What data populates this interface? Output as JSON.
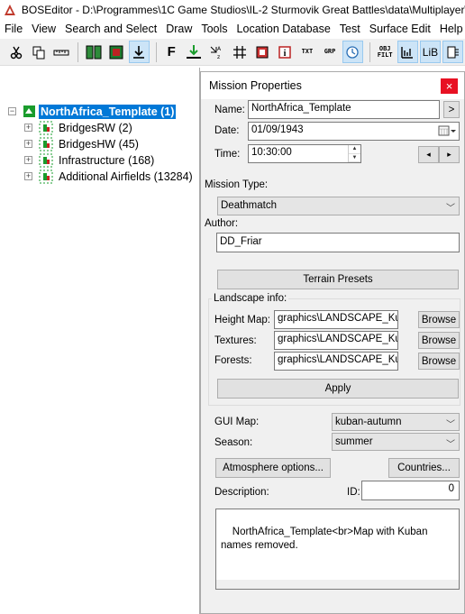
{
  "window": {
    "title": "BOSEditor - D:\\Programmes\\1C Game Studios\\IL-2 Sturmovik Great Battles\\data\\Multiplayer\\"
  },
  "menu": [
    "File",
    "View",
    "Search and Select",
    "Draw",
    "Tools",
    "Location Database",
    "Test",
    "Surface Edit",
    "Help"
  ],
  "toolbar": {
    "icons": [
      "cut-icon",
      "copy-icon",
      "ruler-icon",
      "group-icon",
      "object-icon",
      "import-icon",
      "font-icon",
      "download-icon",
      "reference-point-icon",
      "grid-icon",
      "layers-icon",
      "info-icon",
      "txt-icon",
      "grp-icon",
      "timer-icon",
      "obj-filter-icon",
      "landscape-icon",
      "lib-icon",
      "export-icon"
    ],
    "txt_label": "TXT",
    "grp_label": "GRP",
    "obj_label": "OBJ",
    "filt_label": "FILT",
    "lib_label": "LiB"
  },
  "tree": [
    {
      "label": "NorthAfrica_Template (1)",
      "selected": true
    },
    {
      "label": "BridgesRW (2)"
    },
    {
      "label": "BridgesHW (45)"
    },
    {
      "label": "Infrastructure (168)"
    },
    {
      "label": "Additional Airfields (13284)"
    }
  ],
  "dialog": {
    "title": "Mission Properties",
    "close": "×",
    "name_label": "Name:",
    "name_value": "NorthAfrica_Template",
    "name_btn": ">",
    "date_label": "Date:",
    "date_value": "01/09/1943",
    "time_label": "Time:",
    "time_value": "10:30:00",
    "prev_btn": "◂",
    "next_btn": "▸",
    "mission_type_label": "Mission Type:",
    "mission_type_value": "Deathmatch",
    "author_label": "Author:",
    "author_value": "DD_Friar",
    "terrain_presets": "Terrain Presets",
    "landscape_label": "Landscape info:",
    "height_map_label": "Height Map:",
    "height_map_value": "graphics\\LANDSCAPE_Kuban",
    "textures_label": "Textures:",
    "textures_value": "graphics\\LANDSCAPE_Kuban",
    "forests_label": "Forests:",
    "forests_value": "graphics\\LANDSCAPE_Kuban",
    "browse": "Browse",
    "apply": "Apply",
    "gui_map_label": "GUI Map:",
    "gui_map_value": "kuban-autumn",
    "season_label": "Season:",
    "season_value": "summer",
    "atmosphere_btn": "Atmosphere options...",
    "countries_btn": "Countries...",
    "description_label": "Description:",
    "id_label": "ID:",
    "id_value": "0",
    "description_value": "NorthAfrica_Template<br>Map with Kuban names removed."
  }
}
